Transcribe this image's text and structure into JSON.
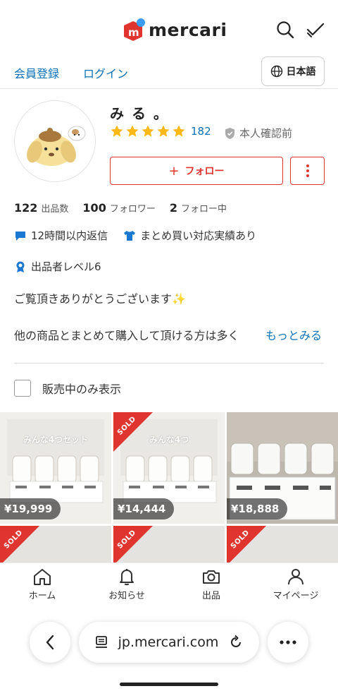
{
  "header": {
    "logo_text": "mercari",
    "brand_color": "#e0352f",
    "icons": [
      "search-icon",
      "todo-check-icon"
    ]
  },
  "auth": {
    "register": "会員登録",
    "login": "ログイン",
    "language": "日本語"
  },
  "profile": {
    "name": "み る 。",
    "rating_stars": 5,
    "rating_count": "182",
    "verification": "本人確認前",
    "follow_label": "フォロー",
    "stats": [
      {
        "num": "122",
        "label": "出品数"
      },
      {
        "num": "100",
        "label": "フォロワー"
      },
      {
        "num": "2",
        "label": "フォロー中"
      }
    ],
    "badges": [
      {
        "icon": "chat-bubble-icon",
        "text": "12時間以内返信"
      },
      {
        "icon": "shirt-icon",
        "text": "まとめ買い対応実績あり"
      }
    ],
    "level_badge": {
      "icon": "medal-icon",
      "text": "出品者レベル6"
    },
    "bio_line1": "ご覧頂きありがとうございます✨",
    "bio_line2": "他の商品とまとめて購入して頂ける方は多く",
    "more_link": "もっとみる"
  },
  "filter": {
    "label": "販売中のみ表示",
    "checked": false
  },
  "items": [
    {
      "price": "¥19,999",
      "sold": false,
      "caption": "みんな4つセット"
    },
    {
      "price": "¥14,444",
      "sold": true,
      "caption": "みんな4つ"
    },
    {
      "price": "¥18,888",
      "sold": false,
      "caption": ""
    },
    {
      "price": "",
      "sold": true,
      "caption": ""
    },
    {
      "price": "",
      "sold": true,
      "caption": ""
    },
    {
      "price": "",
      "sold": true,
      "caption": ""
    }
  ],
  "sold_label": "SOLD",
  "tabbar": {
    "home": "ホーム",
    "notifications": "お知らせ",
    "sell": "出品",
    "mypage": "マイページ"
  },
  "browser": {
    "url": "jp.mercari.com"
  }
}
